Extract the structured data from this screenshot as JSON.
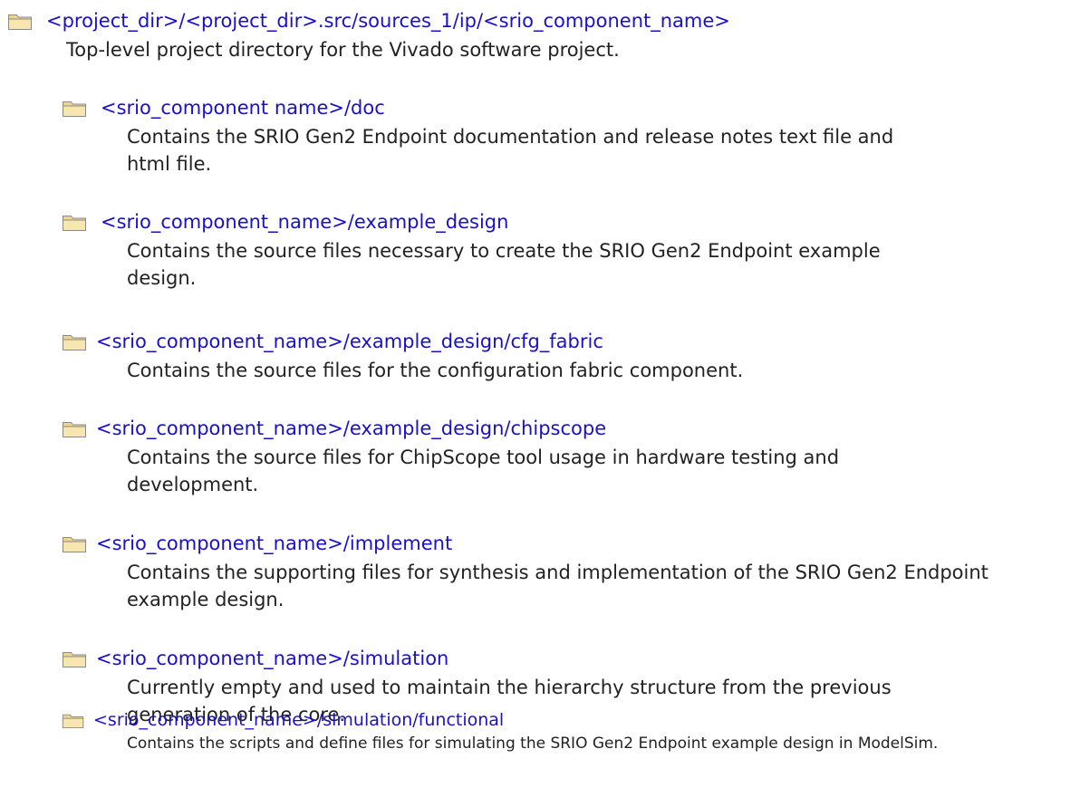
{
  "entries": [
    {
      "path": "<project_dir>/<project_dir>.src/sources_1/ip/<srio_component_name>",
      "desc": "Top-level project directory for the Vivado software project."
    },
    {
      "path": "<srio_component name>/doc",
      "desc": "Contains the SRIO Gen2 Endpoint documentation and release notes text file and html file."
    },
    {
      "path": "<srio_component_name>/example_design",
      "desc": "Contains the source files necessary to create the SRIO Gen2 Endpoint example design."
    },
    {
      "path": "<srio_component_name>/example_design/cfg_fabric",
      "desc": "Contains the source files for the configuration fabric component."
    },
    {
      "path": "<srio_component_name>/example_design/chipscope",
      "desc": "Contains the source files for ChipScope tool usage in hardware testing and development."
    },
    {
      "path": "<srio_component_name>/implement",
      "desc": "Contains the supporting files for synthesis and implementation of the SRIO Gen2 Endpoint example design."
    },
    {
      "path": "<srio_component_name>/simulation",
      "desc": "Currently empty and used to maintain the hierarchy structure from the previous generation of the core."
    },
    {
      "path": "<srio_component_name>/simulation/functional",
      "desc": "Contains the scripts and define files for simulating the SRIO Gen2 Endpoint example design in ModelSim."
    }
  ],
  "icons": {
    "folder": "folder-icon"
  },
  "colors": {
    "link": "#1a10cc",
    "text": "#222222",
    "folder_fill": "#f1d98f",
    "folder_edge": "#8a8a8a"
  }
}
